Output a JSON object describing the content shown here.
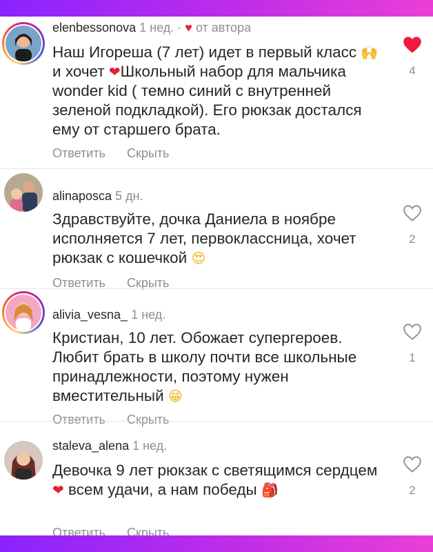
{
  "colors": {
    "accent_heart": "#ed1c3f",
    "secondary_text": "#8e8e8e",
    "primary_text": "#262626"
  },
  "comments": [
    {
      "username": "elenbessonova",
      "time": "1 нед.",
      "dot": "·",
      "author_badge": "от автора",
      "text_1": "Наш Игореша (7 лет) идет в первый класс",
      "emoji_1": "🙌",
      "text_2": "и хочет",
      "emoji_2": "❤",
      "text_3": "Школьный набор для мальчика wonder kid ( темно синий с внутренней  зеленой подкладкой). Его рюкзак достался ему от старшего брата.",
      "reply": "Ответить",
      "hide": "Скрыть",
      "likes": "4",
      "liked": true,
      "avatar_icon": "user-avatar"
    },
    {
      "username": "alinaposca",
      "time": "5 дн.",
      "text_1": "Здравствуйте, дочка Даниела в ноябре исполняется 7 лет, первоклассница, хочет рюкзак с кошечкой",
      "emoji_1": "😍",
      "reply": "Ответить",
      "hide": "Скрыть",
      "likes": "2",
      "liked": false,
      "avatar_icon": "user-avatar"
    },
    {
      "username": "alivia_vesna_",
      "time": "1 нед.",
      "text_1": "Кристиан, 10 лет. Обожает супергероев. Любит брать в школу почти все школьные принадлежности, поэтому нужен вместительный",
      "emoji_1": "😁",
      "reply": "Ответить",
      "hide": "Скрыть",
      "likes": "1",
      "liked": false,
      "avatar_icon": "user-avatar"
    },
    {
      "username": "staleva_alena",
      "time": "1 нед.",
      "text_1": "Девочка 9 лет рюкзак с светящимся сердцем",
      "emoji_1": "❤",
      "text_2": "всем удачи, а нам победы",
      "emoji_2": "🎒",
      "reply": "Ответить",
      "hide": "Скрыть",
      "likes": "2",
      "liked": false,
      "avatar_icon": "user-avatar"
    }
  ]
}
